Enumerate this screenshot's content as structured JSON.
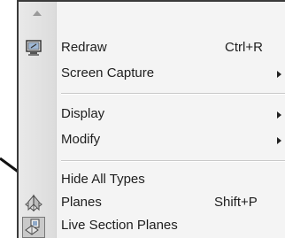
{
  "menu": {
    "items": [
      {
        "label": "Redraw",
        "shortcut": "Ctrl+R",
        "icon": "redraw-icon",
        "submenu": false
      },
      {
        "label": "Screen Capture",
        "shortcut": "",
        "submenu": true
      },
      {
        "label": "Display",
        "shortcut": "",
        "submenu": true
      },
      {
        "label": "Modify",
        "shortcut": "",
        "submenu": true
      },
      {
        "label": "Hide All Types",
        "shortcut": "",
        "submenu": false
      },
      {
        "label": "Planes",
        "shortcut": "Shift+P",
        "icon": "planes-icon",
        "submenu": false
      },
      {
        "label": "Live Section Planes",
        "shortcut": "",
        "icon": "live-section-planes-icon",
        "submenu": false
      }
    ]
  },
  "colors": {
    "menu_background": "#f4f4f4",
    "gutter": "#dcdcdc",
    "text": "#1e1e1e",
    "annotation_arrow": "#111111"
  }
}
